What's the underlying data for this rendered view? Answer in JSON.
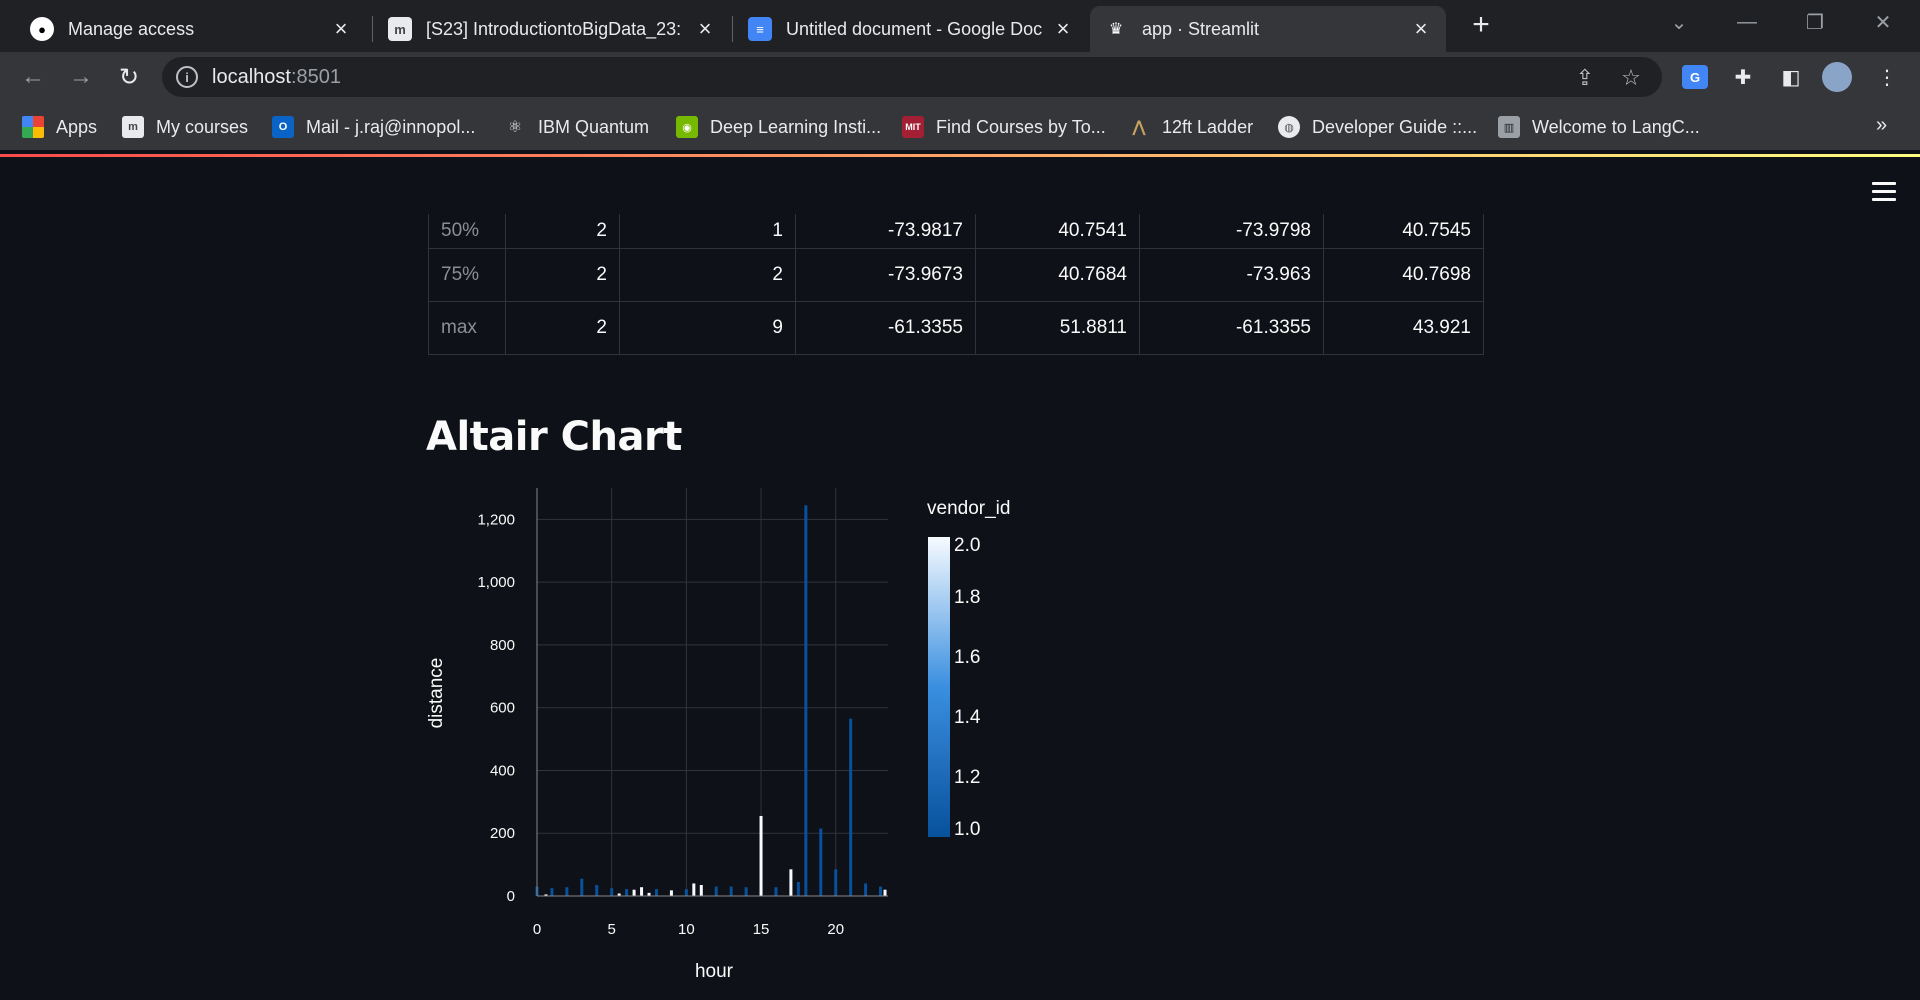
{
  "browser": {
    "tabs": [
      {
        "title": "Manage access",
        "icon": "github-icon"
      },
      {
        "title": "[S23] IntroductiontoBigData_23: I",
        "icon": "moodle-icon"
      },
      {
        "title": "Untitled document - Google Doc",
        "icon": "google-docs-icon"
      },
      {
        "title": "app · Streamlit",
        "icon": "streamlit-icon",
        "active": true
      }
    ],
    "url_host": "localhost",
    "url_port": ":8501",
    "bookmarks": [
      {
        "label": "Apps",
        "icon": "apps-grid-icon"
      },
      {
        "label": "My courses",
        "icon": "moodle-icon"
      },
      {
        "label": "Mail - j.raj@innopol...",
        "icon": "outlook-icon"
      },
      {
        "label": "IBM Quantum",
        "icon": "ibm-quantum-icon"
      },
      {
        "label": "Deep Learning Insti...",
        "icon": "nvidia-icon"
      },
      {
        "label": "Find Courses by To...",
        "icon": "mit-ocw-icon"
      },
      {
        "label": "12ft Ladder",
        "icon": "ladder-icon"
      },
      {
        "label": "Developer Guide ::...",
        "icon": "globe-icon"
      },
      {
        "label": "Welcome to LangC...",
        "icon": "langchain-icon"
      }
    ]
  },
  "table": {
    "rows": [
      {
        "index": "50%",
        "cells": [
          "2",
          "1",
          "-73.9817",
          "40.7541",
          "-73.9798",
          "40.7545"
        ]
      },
      {
        "index": "75%",
        "cells": [
          "2",
          "2",
          "-73.9673",
          "40.7684",
          "-73.963",
          "40.7698"
        ]
      },
      {
        "index": "max",
        "cells": [
          "2",
          "9",
          "-61.3355",
          "51.8811",
          "-61.3355",
          "43.921"
        ]
      }
    ]
  },
  "section_title": "Altair Chart",
  "chart_data": {
    "type": "bar",
    "xlabel": "hour",
    "ylabel": "distance",
    "xlim": [
      0,
      23.5
    ],
    "ylim": [
      0,
      1300
    ],
    "x_ticks": [
      0,
      5,
      10,
      15,
      20
    ],
    "y_ticks": [
      0,
      200,
      400,
      600,
      800,
      1000,
      1200
    ],
    "legend_title": "vendor_id",
    "legend_ticks": [
      "2.0",
      "1.8",
      "1.6",
      "1.4",
      "1.2",
      "1.0"
    ],
    "legend_position": "right",
    "grid": true,
    "bars": [
      {
        "hour": 0,
        "distance": 30,
        "vendor_id": 1
      },
      {
        "hour": 0.6,
        "distance": 5,
        "vendor_id": 2
      },
      {
        "hour": 1,
        "distance": 25,
        "vendor_id": 1
      },
      {
        "hour": 2,
        "distance": 28,
        "vendor_id": 1
      },
      {
        "hour": 3,
        "distance": 55,
        "vendor_id": 1
      },
      {
        "hour": 4,
        "distance": 35,
        "vendor_id": 1
      },
      {
        "hour": 5,
        "distance": 25,
        "vendor_id": 1
      },
      {
        "hour": 5.5,
        "distance": 8,
        "vendor_id": 2
      },
      {
        "hour": 6,
        "distance": 22,
        "vendor_id": 1
      },
      {
        "hour": 6.5,
        "distance": 20,
        "vendor_id": 2
      },
      {
        "hour": 7,
        "distance": 28,
        "vendor_id": 2
      },
      {
        "hour": 7.5,
        "distance": 10,
        "vendor_id": 2
      },
      {
        "hour": 8,
        "distance": 22,
        "vendor_id": 1
      },
      {
        "hour": 9,
        "distance": 18,
        "vendor_id": 2
      },
      {
        "hour": 10,
        "distance": 22,
        "vendor_id": 1
      },
      {
        "hour": 10.5,
        "distance": 40,
        "vendor_id": 2
      },
      {
        "hour": 11,
        "distance": 35,
        "vendor_id": 2
      },
      {
        "hour": 12,
        "distance": 30,
        "vendor_id": 1
      },
      {
        "hour": 13,
        "distance": 30,
        "vendor_id": 1
      },
      {
        "hour": 14,
        "distance": 28,
        "vendor_id": 1
      },
      {
        "hour": 15,
        "distance": 255,
        "vendor_id": 2
      },
      {
        "hour": 16,
        "distance": 28,
        "vendor_id": 1
      },
      {
        "hour": 17,
        "distance": 85,
        "vendor_id": 2
      },
      {
        "hour": 17.5,
        "distance": 45,
        "vendor_id": 1
      },
      {
        "hour": 18,
        "distance": 1245,
        "vendor_id": 1
      },
      {
        "hour": 19,
        "distance": 215,
        "vendor_id": 1
      },
      {
        "hour": 20,
        "distance": 85,
        "vendor_id": 1
      },
      {
        "hour": 21,
        "distance": 565,
        "vendor_id": 1
      },
      {
        "hour": 22,
        "distance": 40,
        "vendor_id": 1
      },
      {
        "hour": 23,
        "distance": 30,
        "vendor_id": 1
      },
      {
        "hour": 23.3,
        "distance": 20,
        "vendor_id": 2
      }
    ]
  },
  "colors": {
    "app_bg": "#0e1117",
    "text": "#fafafa",
    "grid": "#31333f",
    "bar_low": "#08519c",
    "bar_high": "#f7fbff"
  }
}
